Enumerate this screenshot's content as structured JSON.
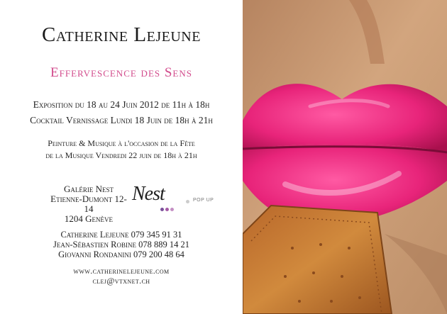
{
  "artist_name": "Catherine Lejeune",
  "exhibition_title": "Effervescence des Sens",
  "dates": {
    "exposition": "Exposition du 18 au 24 Juin 2012 de 11h à 18h",
    "vernissage": "Cocktail Vernissage Lundi 18 Juin de 18h à 21h"
  },
  "music_event": {
    "line1": "Peinture & Musique à l'occasion de la Fête",
    "line2": "de la Musique Vendredi 22 juin de 18h à 21h"
  },
  "venue": {
    "name": "Galérie Nest",
    "street": "Etienne-Dumont 12-14",
    "city": "1204 Genève"
  },
  "logo": {
    "word": "Nest",
    "tag": "POP UP",
    "dot_colors": [
      "#7a4f9a",
      "#a65aa6",
      "#c48fc4"
    ],
    "tag_dot_color": "#cccccc"
  },
  "contacts": [
    "Catherine Lejeune 079 345 91 31",
    "Jean-Sébastien Robine 078 889 14 21",
    "Giovanni Rondanini 079 200 48 64"
  ],
  "website": "www.catherinelejeune.com",
  "email": "clej@vtxnet.ch",
  "colors": {
    "title_pink": "#d24b8c",
    "lip_pink": "#e8247a",
    "skin": "#c99a73",
    "biscuit": "#c67a2e"
  }
}
